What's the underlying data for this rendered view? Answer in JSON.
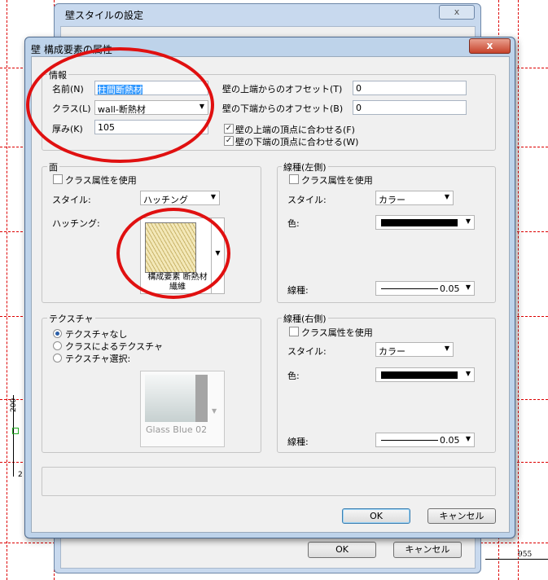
{
  "background_dialog": {
    "title": "壁スタイルの設定",
    "ok_label": "OK",
    "cancel_label": "キャンセル"
  },
  "dimension_labels": {
    "d200": "200",
    "d2": "2",
    "d955": "955"
  },
  "dialog": {
    "title": "壁 構成要素の属性",
    "close_label": "x",
    "info": {
      "group_label": "情報",
      "name_label": "名前(N)",
      "name_value": "柱間断熱材",
      "class_label": "クラス(L)",
      "class_value": "wall-断熱材",
      "thickness_label": "厚み(K)",
      "thickness_value": "105",
      "top_offset_label": "壁の上端からのオフセット(T)",
      "top_offset_value": "0",
      "bottom_offset_label": "壁の下端からのオフセット(B)",
      "bottom_offset_value": "0",
      "snap_top_label": "壁の上端の頂点に合わせる(F)",
      "snap_top_checked": true,
      "snap_bottom_label": "壁の下端の頂点に合わせる(W)",
      "snap_bottom_checked": true
    },
    "face": {
      "group_label": "面",
      "use_class_label": "クラス属性を使用",
      "style_label": "スタイル:",
      "style_value": "ハッチング",
      "hatching_label": "ハッチング:",
      "hatch_name": "構成要素 断熱材 繊維"
    },
    "line_left": {
      "group_label": "線種(左側)",
      "use_class_label": "クラス属性を使用",
      "style_label": "スタイル:",
      "style_value": "カラー",
      "color_label": "色:",
      "line_type_label": "線種:",
      "line_weight": "0.05"
    },
    "texture": {
      "group_label": "テクスチャ",
      "options": [
        "テクスチャなし",
        "クラスによるテクスチャ",
        "テクスチャ選択:"
      ],
      "selected_index": 0,
      "texture_name": "Glass Blue 02"
    },
    "line_right": {
      "group_label": "線種(右側)",
      "use_class_label": "クラス属性を使用",
      "style_label": "スタイル:",
      "style_value": "カラー",
      "color_label": "色:",
      "line_type_label": "線種:",
      "line_weight": "0.05"
    },
    "ok_label": "OK",
    "cancel_label": "キャンセル"
  },
  "colors": {
    "annotation_red": "#e01010",
    "title_bar": "#bed3ea",
    "line_color": "#000000"
  }
}
